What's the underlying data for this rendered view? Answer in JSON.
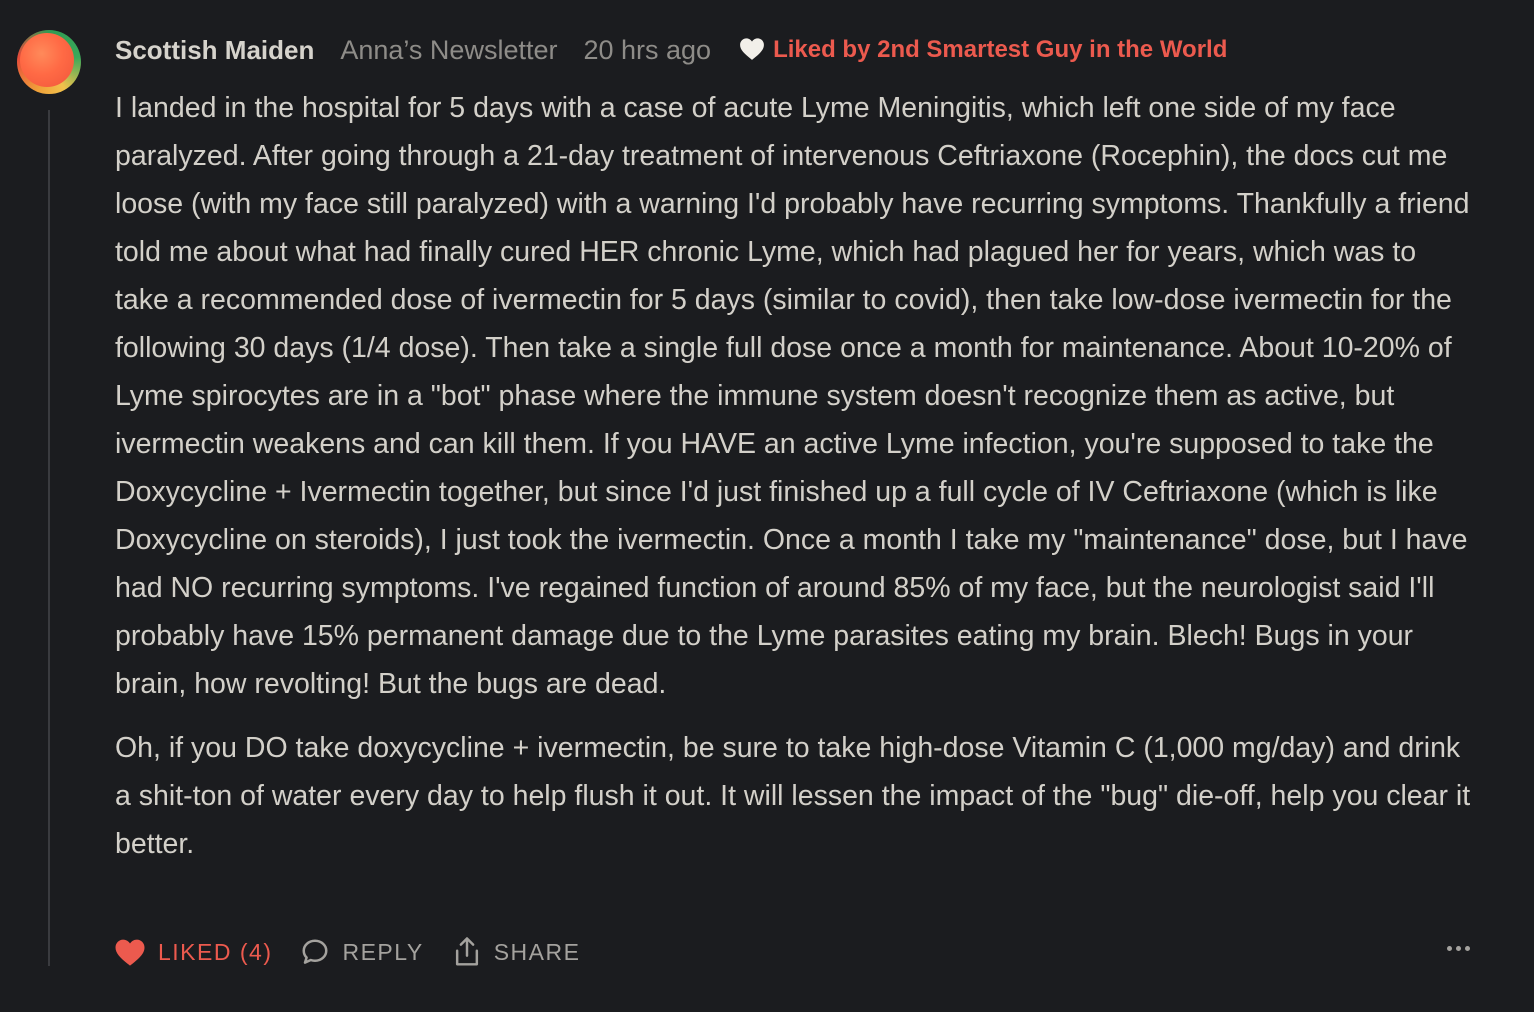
{
  "comment": {
    "author": "Scottish Maiden",
    "publication": "Anna’s Newsletter",
    "timestamp": "20 hrs ago",
    "liked_by": "Liked by 2nd Smartest Guy in the World",
    "paragraphs": [
      "I landed in the hospital for 5 days with a case of acute Lyme Meningitis, which left one side of my face paralyzed. After going through a 21-day treatment of intervenous Ceftriaxone (Rocephin), the docs cut me loose (with my face still paralyzed) with a warning I'd probably have recurring symptoms. Thankfully a friend told me about what had finally cured HER chronic Lyme, which had plagued her for years, which was to take a recommended dose of ivermectin for 5 days (similar to covid), then take low-dose ivermectin for the following 30 days (1/4 dose). Then take a single full dose once a month for maintenance. About 10-20% of Lyme spirocytes are in a \"bot\" phase where the immune system doesn't recognize them as active, but ivermectin weakens and can kill them. If you HAVE an active Lyme infection, you're supposed to take the Doxycycline + Ivermectin together, but since I'd just finished up a full cycle of IV Ceftriaxone (which is like Doxycycline on steroids), I just took the ivermectin. Once a month I take my \"maintenance\" dose, but I have had NO recurring symptoms. I've regained function of around 85% of my face, but the neurologist said I'll probably have 15% permanent damage due to the Lyme parasites eating my brain. Blech! Bugs in your brain, how revolting! But the bugs are dead.",
      "Oh, if you DO take doxycycline + ivermectin, be sure to take high-dose Vitamin C (1,000 mg/day) and drink a shit-ton of water every day to help flush it out. It will lessen the impact of the \"bug\" die-off, help you clear it better."
    ]
  },
  "actions": {
    "like_label": "LIKED (4)",
    "reply_label": "REPLY",
    "share_label": "SHARE"
  },
  "colors": {
    "background": "#1b1c1f",
    "text": "#d3d0c9",
    "muted": "#8e8c88",
    "accent_red": "#ec5a4e"
  },
  "icons": {
    "liked_by": "heart-outline-white-icon",
    "like": "heart-filled-icon",
    "reply": "speech-bubble-icon",
    "share": "share-upload-icon",
    "more": "ellipsis-icon"
  }
}
